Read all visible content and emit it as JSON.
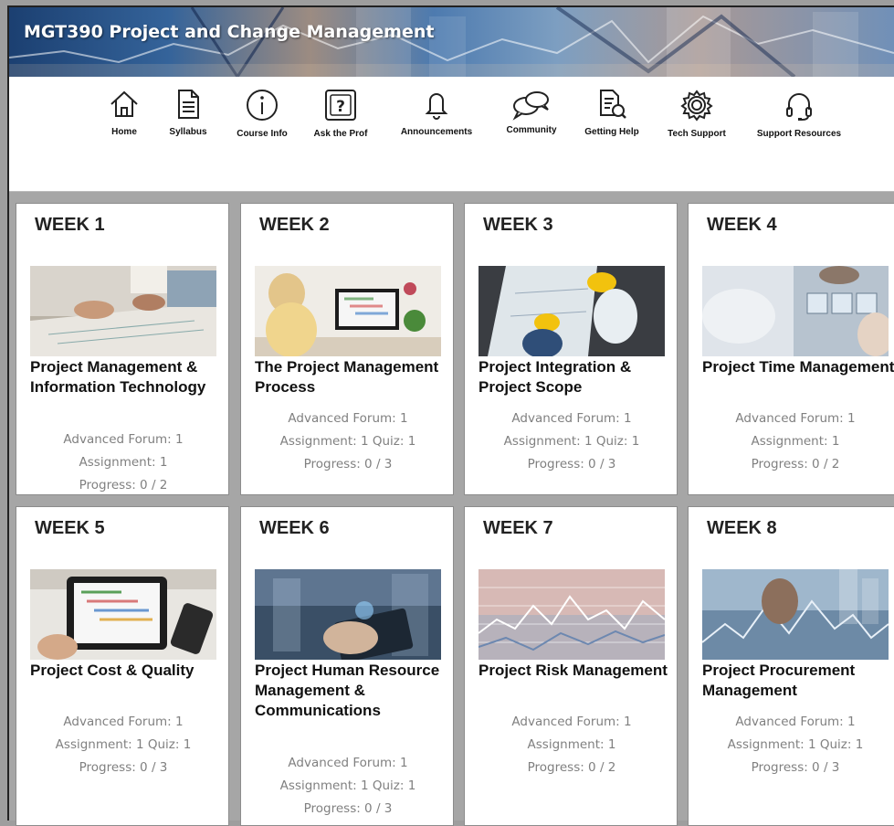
{
  "course": {
    "title": "MGT390 Project and Change Management"
  },
  "nav": [
    {
      "label": "Home",
      "icon": "home-icon"
    },
    {
      "label": "Syllabus",
      "icon": "document-icon"
    },
    {
      "label": "Course Info",
      "icon": "info-icon"
    },
    {
      "label": "Ask the Prof",
      "icon": "question-icon"
    },
    {
      "label": "Announcements",
      "icon": "bell-icon"
    },
    {
      "label": "Community",
      "icon": "chat-bubbles-icon"
    },
    {
      "label": "Getting Help",
      "icon": "document-search-icon"
    },
    {
      "label": "Tech Support",
      "icon": "gear-icon"
    },
    {
      "label": "Support Resources",
      "icon": "headset-icon"
    }
  ],
  "weeks": [
    {
      "title": "WEEK 1",
      "heading": "Project Management & Information Technology",
      "forum": "Advanced Forum: 1",
      "items": "Assignment: 1",
      "progress": "Progress: 0 / 2"
    },
    {
      "title": "WEEK 2",
      "heading": "The Project Management Process",
      "forum": "Advanced Forum: 1",
      "items": "Assignment: 1  Quiz: 1",
      "progress": "Progress: 0 / 3"
    },
    {
      "title": "WEEK 3",
      "heading": "Project Integration & Project Scope",
      "forum": "Advanced Forum: 1",
      "items": "Assignment: 1  Quiz: 1",
      "progress": "Progress: 0 / 3"
    },
    {
      "title": "WEEK 4",
      "heading": "Project Time Management",
      "forum": "Advanced Forum: 1",
      "items": "Assignment: 1",
      "progress": "Progress: 0 / 2"
    },
    {
      "title": "WEEK 5",
      "heading": "Project Cost & Quality",
      "forum": "Advanced Forum: 1",
      "items": "Assignment: 1  Quiz: 1",
      "progress": "Progress: 0 / 3"
    },
    {
      "title": "WEEK 6",
      "heading": "Project Human Resource Management & Communications",
      "forum": "Advanced Forum: 1",
      "items": "Assignment: 1  Quiz: 1",
      "progress": "Progress: 0 / 3"
    },
    {
      "title": "WEEK 7",
      "heading": "Project Risk Management",
      "forum": "Advanced Forum: 1",
      "items": "Assignment: 1",
      "progress": "Progress: 0 / 2"
    },
    {
      "title": "WEEK 8",
      "heading": "Project Procurement Management",
      "forum": "Advanced Forum: 1",
      "items": "Assignment: 1  Quiz: 1",
      "progress": "Progress: 0 / 3"
    }
  ]
}
